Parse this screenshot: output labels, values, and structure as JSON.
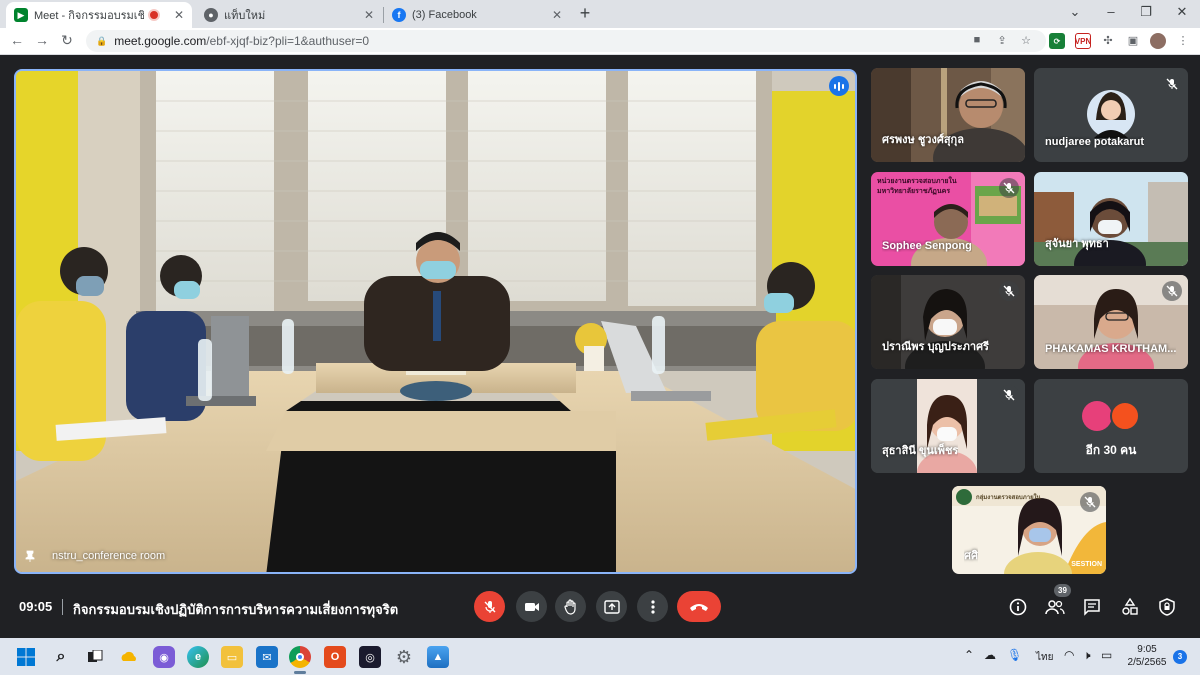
{
  "browser": {
    "tabs": [
      {
        "title": "Meet - กิจกรรมอบรมเชิงปฏิบัติก",
        "favicon": "google-meet-icon",
        "recording": true,
        "active": true
      },
      {
        "title": "แท็บใหม่",
        "favicon": "chrome-icon",
        "active": false
      },
      {
        "title": "(3) Facebook",
        "favicon": "facebook-icon",
        "active": false
      }
    ],
    "url_host": "meet.google.com",
    "url_path": "/ebf-xjqf-biz?pli=1&authuser=0"
  },
  "meet": {
    "main_tile_label": "nstru_conference room",
    "participants": [
      {
        "name": "ศรพงษ ชูวงศ์สุกุล"
      },
      {
        "name": "nudjaree potakarut"
      },
      {
        "name": "Sophee Senpong",
        "slide_text": "หน่วยงานตรวจสอบภายใน มหาวิทยาลัยราชภัฏนคร"
      },
      {
        "name": "สุจันยา พุทธา"
      },
      {
        "name": "ปราณีพร บุญประภาศรี"
      },
      {
        "name": "PHAKAMAS KRUTHAM..."
      },
      {
        "name": "สุธาสินี ขุนเพ็ชร"
      },
      {
        "name": "ศศิ",
        "slide_text": "กลุ่มงานตรวจสอบภายใน",
        "slide_word": "SESTION"
      }
    ],
    "more_count": "อีก 30 คน",
    "time": "09:05",
    "meeting_title": "กิจกรรมอบรมเชิงปฏิบัติการการบริหารความเสี่ยงการทุจริต",
    "people_badge": "39"
  },
  "taskbar": {
    "lang": "ไทย",
    "time": "9:05",
    "date": "2/5/2565",
    "notifications": "3"
  },
  "colors": {
    "meet_bg": "#202124",
    "end_call": "#ea4335",
    "active_border": "#8ab4f8"
  }
}
